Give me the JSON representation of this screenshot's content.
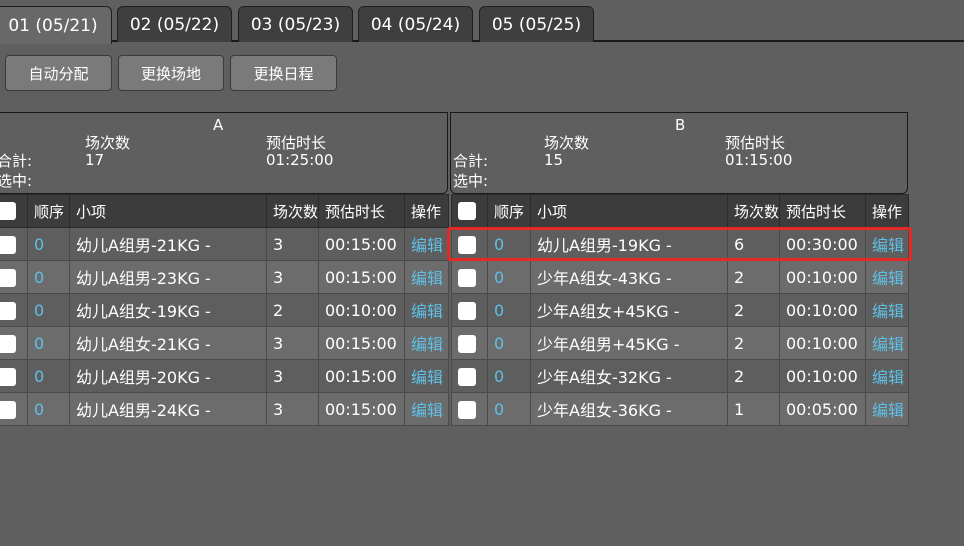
{
  "tabs": [
    {
      "label": "01 (05/21)"
    },
    {
      "label": "02 (05/22)"
    },
    {
      "label": "03 (05/23)"
    },
    {
      "label": "04 (05/24)"
    },
    {
      "label": "05 (05/25)"
    }
  ],
  "toolbar": {
    "auto_assign": "自动分配",
    "change_venue": "更换场地",
    "change_schedule": "更换日程"
  },
  "panels": {
    "A": {
      "title": "A",
      "sessions_header": "场次数",
      "duration_header": "预估时长",
      "total_label": "合計:",
      "selected_label": "选中:",
      "total_sessions": "17",
      "total_duration": "01:25:00",
      "columns": [
        "顺序",
        "小项",
        "场次数",
        "预估时长",
        "操作"
      ],
      "rows": [
        {
          "order": "0",
          "item": "幼儿A组男-21KG -",
          "sessions": "3",
          "duration": "00:15:00",
          "action": "编辑"
        },
        {
          "order": "0",
          "item": "幼儿A组男-23KG -",
          "sessions": "3",
          "duration": "00:15:00",
          "action": "编辑"
        },
        {
          "order": "0",
          "item": "幼儿A组女-19KG -",
          "sessions": "2",
          "duration": "00:10:00",
          "action": "编辑"
        },
        {
          "order": "0",
          "item": "幼儿A组女-21KG -",
          "sessions": "3",
          "duration": "00:15:00",
          "action": "编辑"
        },
        {
          "order": "0",
          "item": "幼儿A组男-20KG -",
          "sessions": "3",
          "duration": "00:15:00",
          "action": "编辑"
        },
        {
          "order": "0",
          "item": "幼儿A组男-24KG -",
          "sessions": "3",
          "duration": "00:15:00",
          "action": "编辑"
        }
      ]
    },
    "B": {
      "title": "B",
      "sessions_header": "场次数",
      "duration_header": "预估时长",
      "total_label": "合計:",
      "selected_label": "选中:",
      "total_sessions": "15",
      "total_duration": "01:15:00",
      "columns": [
        "顺序",
        "小项",
        "场次数",
        "预估时长",
        "操作"
      ],
      "rows": [
        {
          "order": "0",
          "item": "幼儿A组男-19KG -",
          "sessions": "6",
          "duration": "00:30:00",
          "action": "编辑"
        },
        {
          "order": "0",
          "item": "少年A组女-43KG -",
          "sessions": "2",
          "duration": "00:10:00",
          "action": "编辑"
        },
        {
          "order": "0",
          "item": "少年A组女+45KG -",
          "sessions": "2",
          "duration": "00:10:00",
          "action": "编辑"
        },
        {
          "order": "0",
          "item": "少年A组男+45KG -",
          "sessions": "2",
          "duration": "00:10:00",
          "action": "编辑"
        },
        {
          "order": "0",
          "item": "少年A组女-32KG -",
          "sessions": "2",
          "duration": "00:10:00",
          "action": "编辑"
        },
        {
          "order": "0",
          "item": "少年A组女-36KG -",
          "sessions": "1",
          "duration": "00:05:00",
          "action": "编辑"
        }
      ]
    }
  },
  "colors": {
    "link": "#5fc0e6",
    "highlight": "#e32a24",
    "background": "#5f5f5f"
  }
}
